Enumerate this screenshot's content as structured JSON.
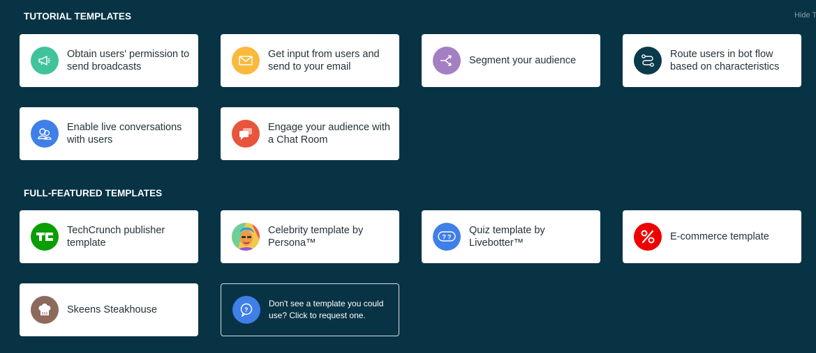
{
  "header": {
    "hide_label": "Hide T"
  },
  "tutorial": {
    "title": "TUTORIAL TEMPLATES",
    "cards": [
      {
        "label": "Obtain users' permission to send broadcasts",
        "icon": "megaphone-icon",
        "color": "#40c39a"
      },
      {
        "label": "Get input from users and send to your email",
        "icon": "envelope-icon",
        "color": "#f9b93c"
      },
      {
        "label": "Segment your audience",
        "icon": "split-arrows-icon",
        "color": "#a47fc2"
      },
      {
        "label": "Route users in bot flow based on characteristics",
        "icon": "route-icon",
        "color": "#0b3a4b"
      },
      {
        "label": "Enable live conversations with users",
        "icon": "users-chat-icon",
        "color": "#3f7fe8"
      },
      {
        "label": "Engage your audience with a Chat Room",
        "icon": "chat-bubbles-icon",
        "color": "#e8543c"
      }
    ]
  },
  "full": {
    "title": "FULL-FEATURED TEMPLATES",
    "cards": [
      {
        "label": "TechCrunch publisher template",
        "icon": "techcrunch-logo-icon",
        "color": "#0a9e01"
      },
      {
        "label": "Celebrity template by Persona™",
        "icon": "celebrity-portrait-icon",
        "color": "#e9a33b"
      },
      {
        "label": "Quiz template by Livebotter™",
        "icon": "quiz-bubbles-icon",
        "color": "#3f7fe8"
      },
      {
        "label": "E-commerce template",
        "icon": "percent-icon",
        "color": "#ee0000"
      },
      {
        "label": "Skeens Steakhouse",
        "icon": "chef-hat-icon",
        "color": "#8c6a5c"
      }
    ],
    "request": {
      "label": "Don't see a template you could use? Click to request one.",
      "icon": "question-bubble-icon",
      "color": "#3f7fe8"
    }
  }
}
